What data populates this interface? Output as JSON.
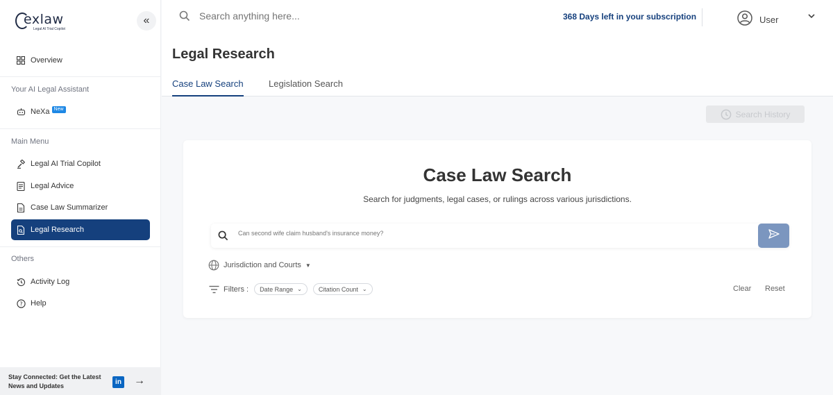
{
  "brand": {
    "name": "exlaw",
    "tagline": "Legal AI Trial Copilot"
  },
  "sidebar": {
    "overview": "Overview",
    "section_assistant": "Your AI Legal Assistant",
    "nexa": "NeXa",
    "nexa_badge": "New",
    "section_main": "Main Menu",
    "items": [
      {
        "label": "Legal AI Trial Copilot"
      },
      {
        "label": "Legal Advice"
      },
      {
        "label": "Case Law Summarizer"
      },
      {
        "label": "Legal Research"
      }
    ],
    "section_others": "Others",
    "activity_log": "Activity Log",
    "help": "Help",
    "footer_text": "Stay Connected: Get the Latest News and Updates",
    "linkedin_label": "in"
  },
  "topbar": {
    "search_placeholder": "Search anything here...",
    "subscription": "368 Days left in your subscription",
    "user": "User"
  },
  "page": {
    "title": "Legal Research",
    "tabs": [
      {
        "label": "Case Law Search"
      },
      {
        "label": "Legislation Search"
      }
    ],
    "history_button": "Search History"
  },
  "card": {
    "title": "Case Law Search",
    "subtitle": "Search for judgments, legal cases, or rulings across various jurisdictions.",
    "search_placeholder": "Can second wife claim husband's insurance money?",
    "jurisdiction": "Jurisdiction and Courts",
    "filters_label": "Filters :",
    "chips": [
      {
        "label": "Date Range"
      },
      {
        "label": "Citation Count"
      }
    ],
    "clear": "Clear",
    "reset": "Reset"
  },
  "colors": {
    "primary": "#15407d",
    "send_button": "#7b96bf",
    "badge": "#1e88e5",
    "linkedin": "#0a66c2"
  }
}
